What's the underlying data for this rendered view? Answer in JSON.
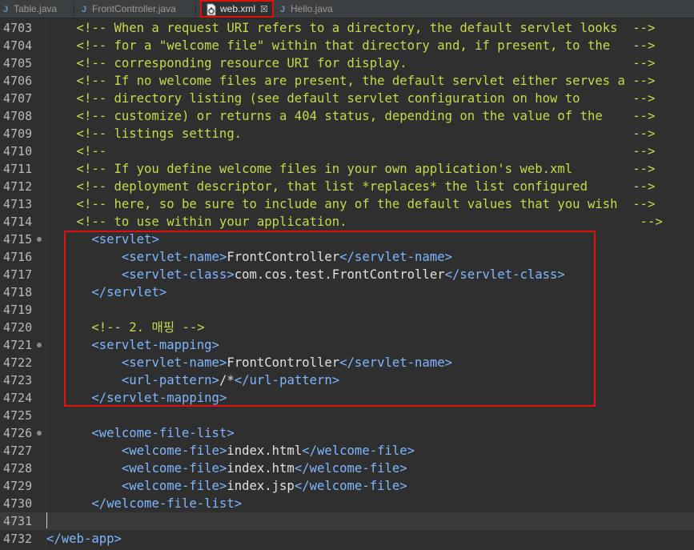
{
  "tabs": [
    {
      "label": "Table.java",
      "icon": "java-file-icon"
    },
    {
      "label": "FrontController.java",
      "icon": "java-file-icon"
    },
    {
      "label": "web.xml",
      "icon": "xml-file-icon",
      "active": true
    },
    {
      "label": "Hello.java",
      "icon": "java-file-icon"
    }
  ],
  "tab_close_glyph": "☒",
  "java_glyph": "J",
  "lines": [
    {
      "n": "4703",
      "parts": [
        [
          "c",
          "    <!-- When a request URI refers to a directory, the default servlet looks  -->"
        ]
      ]
    },
    {
      "n": "4704",
      "parts": [
        [
          "c",
          "    <!-- for a \"welcome file\" within that directory and, if present, to the   -->"
        ]
      ]
    },
    {
      "n": "4705",
      "parts": [
        [
          "c",
          "    <!-- corresponding resource URI for display.                              -->"
        ]
      ]
    },
    {
      "n": "4706",
      "parts": [
        [
          "c",
          "    <!-- If no welcome files are present, the default servlet either serves a -->"
        ]
      ]
    },
    {
      "n": "4707",
      "parts": [
        [
          "c",
          "    <!-- directory listing (see default servlet configuration on how to       -->"
        ]
      ]
    },
    {
      "n": "4708",
      "parts": [
        [
          "c",
          "    <!-- customize) or returns a 404 status, depending on the value of the    -->"
        ]
      ]
    },
    {
      "n": "4709",
      "parts": [
        [
          "c",
          "    <!-- listings setting.                                                    -->"
        ]
      ]
    },
    {
      "n": "4710",
      "parts": [
        [
          "c",
          "    <!--                                                                      -->"
        ]
      ]
    },
    {
      "n": "4711",
      "parts": [
        [
          "c",
          "    <!-- If you define welcome files in your own application's web.xml        -->"
        ]
      ]
    },
    {
      "n": "4712",
      "parts": [
        [
          "c",
          "    <!-- deployment descriptor, that list *replaces* the list configured      -->"
        ]
      ]
    },
    {
      "n": "4713",
      "parts": [
        [
          "c",
          "    <!-- here, so be sure to include any of the default values that you wish  -->"
        ]
      ]
    },
    {
      "n": "4714",
      "parts": [
        [
          "c",
          "    <!-- to use within your application.                                       -->"
        ]
      ]
    },
    {
      "n": "4715",
      "fold": true,
      "parts": [
        [
          "x",
          "      "
        ],
        [
          "t",
          "<servlet>"
        ]
      ]
    },
    {
      "n": "4716",
      "parts": [
        [
          "x",
          "          "
        ],
        [
          "t",
          "<servlet-name>"
        ],
        [
          "x",
          "FrontController"
        ],
        [
          "t",
          "</servlet-name>"
        ]
      ]
    },
    {
      "n": "4717",
      "parts": [
        [
          "x",
          "          "
        ],
        [
          "t",
          "<servlet-class>"
        ],
        [
          "x",
          "com.cos.test.FrontController"
        ],
        [
          "t",
          "</servlet-class>"
        ]
      ]
    },
    {
      "n": "4718",
      "parts": [
        [
          "x",
          "      "
        ],
        [
          "t",
          "</servlet>"
        ]
      ]
    },
    {
      "n": "4719",
      "parts": []
    },
    {
      "n": "4720",
      "parts": [
        [
          "x",
          "      "
        ],
        [
          "c",
          "<!-- 2. 매핑 -->"
        ]
      ]
    },
    {
      "n": "4721",
      "fold": true,
      "parts": [
        [
          "x",
          "      "
        ],
        [
          "t",
          "<servlet-mapping>"
        ]
      ]
    },
    {
      "n": "4722",
      "parts": [
        [
          "x",
          "          "
        ],
        [
          "t",
          "<servlet-name>"
        ],
        [
          "x",
          "FrontController"
        ],
        [
          "t",
          "</servlet-name>"
        ]
      ]
    },
    {
      "n": "4723",
      "parts": [
        [
          "x",
          "          "
        ],
        [
          "t",
          "<url-pattern>"
        ],
        [
          "x",
          "/*"
        ],
        [
          "t",
          "</url-pattern>"
        ]
      ]
    },
    {
      "n": "4724",
      "parts": [
        [
          "x",
          "      "
        ],
        [
          "t",
          "</servlet-mapping>"
        ]
      ]
    },
    {
      "n": "4725",
      "parts": []
    },
    {
      "n": "4726",
      "fold": true,
      "parts": [
        [
          "x",
          "      "
        ],
        [
          "t",
          "<welcome-file-list>"
        ]
      ]
    },
    {
      "n": "4727",
      "parts": [
        [
          "x",
          "          "
        ],
        [
          "t",
          "<welcome-file>"
        ],
        [
          "x",
          "index.html"
        ],
        [
          "t",
          "</welcome-file>"
        ]
      ]
    },
    {
      "n": "4728",
      "parts": [
        [
          "x",
          "          "
        ],
        [
          "t",
          "<welcome-file>"
        ],
        [
          "x",
          "index.htm"
        ],
        [
          "t",
          "</welcome-file>"
        ]
      ]
    },
    {
      "n": "4729",
      "parts": [
        [
          "x",
          "          "
        ],
        [
          "t",
          "<welcome-file>"
        ],
        [
          "x",
          "index.jsp"
        ],
        [
          "t",
          "</welcome-file>"
        ]
      ]
    },
    {
      "n": "4730",
      "parts": [
        [
          "x",
          "      "
        ],
        [
          "t",
          "</welcome-file-list>"
        ]
      ]
    },
    {
      "n": "4731",
      "current": true,
      "parts": []
    },
    {
      "n": "4732",
      "parts": [
        [
          "t",
          "</web-app>"
        ]
      ]
    }
  ]
}
